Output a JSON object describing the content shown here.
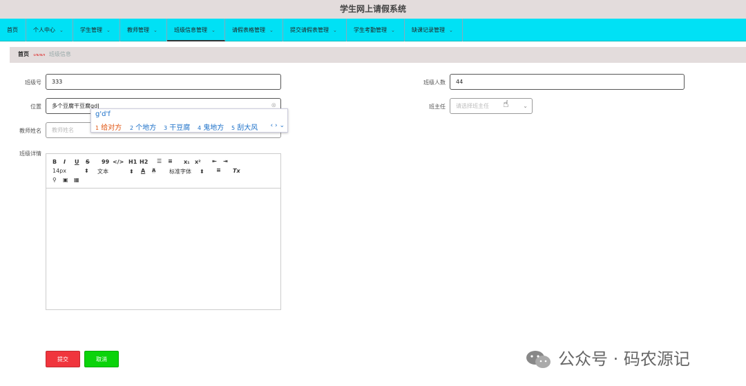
{
  "app": {
    "title": "学生网上请假系统"
  },
  "nav": {
    "items": [
      {
        "label": "首页",
        "dropdown": false
      },
      {
        "label": "个人中心",
        "dropdown": true
      },
      {
        "label": "学生管理",
        "dropdown": true
      },
      {
        "label": "教师管理",
        "dropdown": true
      },
      {
        "label": "班级信息管理",
        "dropdown": true
      },
      {
        "label": "请假表格管理",
        "dropdown": true
      },
      {
        "label": "提交请假表管理",
        "dropdown": true
      },
      {
        "label": "学生考勤管理",
        "dropdown": true
      },
      {
        "label": "缺课记录管理",
        "dropdown": true
      }
    ],
    "active_index": 4
  },
  "breadcrumb": {
    "home": "首页",
    "separator": "ᔕᔕᔕ",
    "current": "班级信息"
  },
  "form": {
    "class_no": {
      "label": "班级号",
      "value": "333"
    },
    "class_size": {
      "label": "班级人数",
      "value": "44"
    },
    "location": {
      "label": "位置",
      "value": "多个豆腐干豆腐gd",
      "clear_icon": "⊗"
    },
    "head_teacher": {
      "label": "班主任",
      "placeholder": "请选择班主任",
      "arrow": "⌄"
    },
    "teacher_name": {
      "label": "教师姓名",
      "placeholder": "教师姓名"
    },
    "details": {
      "label": "班级详情"
    }
  },
  "ime": {
    "composition": "g'd'f",
    "candidates": [
      {
        "num": "1",
        "text": "给对方"
      },
      {
        "num": "2",
        "text": "个地方"
      },
      {
        "num": "3",
        "text": "干豆腐"
      },
      {
        "num": "4",
        "text": "鬼地方"
      },
      {
        "num": "5",
        "text": "刮大风"
      }
    ],
    "nav": "‹ › ⌄"
  },
  "editor": {
    "toolbar_row1": [
      "B",
      "I",
      "U",
      "S",
      "99",
      "</>",
      "H1",
      "H2",
      "☰",
      "≡",
      "x₁",
      "x²",
      "⇤",
      "⇥"
    ],
    "font_size": "14px",
    "text_type": "文本",
    "font_family": "标准字体",
    "color_icons": [
      "A",
      "A"
    ],
    "align_icon": "≡",
    "clear_icon": "Tx",
    "row3": [
      "🔗",
      "▣",
      "▦"
    ]
  },
  "buttons": {
    "submit": "提交",
    "cancel": "取消"
  },
  "colors": {
    "navbar": "#00e1f5",
    "submit": "#f0353d",
    "cancel": "#0bd30b",
    "titlebar": "#e3dcdc"
  },
  "watermark": {
    "text": "公众号 · 码农源记"
  }
}
